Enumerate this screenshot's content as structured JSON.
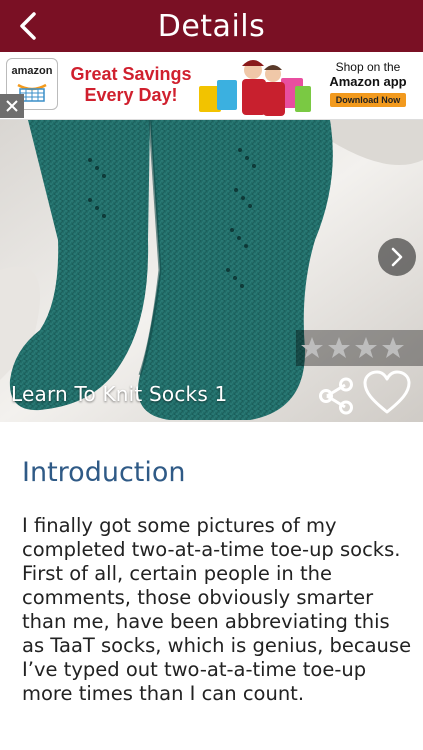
{
  "header": {
    "title": "Details",
    "back_icon": "chevron-left-icon"
  },
  "ad": {
    "logo_text": "amazon",
    "headline_line1": "Great Savings",
    "headline_line2": "Every Day!",
    "right_line1": "Shop on the",
    "right_line2": "Amazon app",
    "button_label": "Download Now",
    "close_icon": "close-icon",
    "headline_color": "#d0202e",
    "button_color": "#f29a1e"
  },
  "hero": {
    "title": "Learn To Knit Socks 1",
    "rating": {
      "value": 4,
      "max": 4
    },
    "next_icon": "chevron-right-icon",
    "share_icon": "share-icon",
    "favorite_icon": "heart-icon"
  },
  "content": {
    "section_title": "Introduction",
    "body": "I finally got some pictures of my completed two-at-a-time toe-up socks.  First of all, certain people in the comments, those obviously smarter than me, have been abbreviating this as TaaT socks, which is genius, because I’ve typed out two-at-a-time toe-up more times than I can count."
  },
  "colors": {
    "header_bg": "#7a1024",
    "title_blue": "#2f5a86",
    "sock_teal": "#1f6a66"
  }
}
